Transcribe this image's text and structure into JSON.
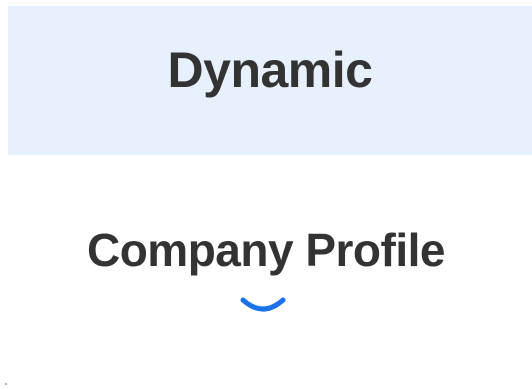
{
  "banner": {
    "title": "Dynamic"
  },
  "main": {
    "heading": "Company Profile"
  },
  "loading": {
    "icon": "loading-spinner-icon",
    "color": "#1a73e8"
  },
  "colors": {
    "banner_background": "#e7f0fd",
    "text": "#333333",
    "accent": "#1a73e8"
  }
}
